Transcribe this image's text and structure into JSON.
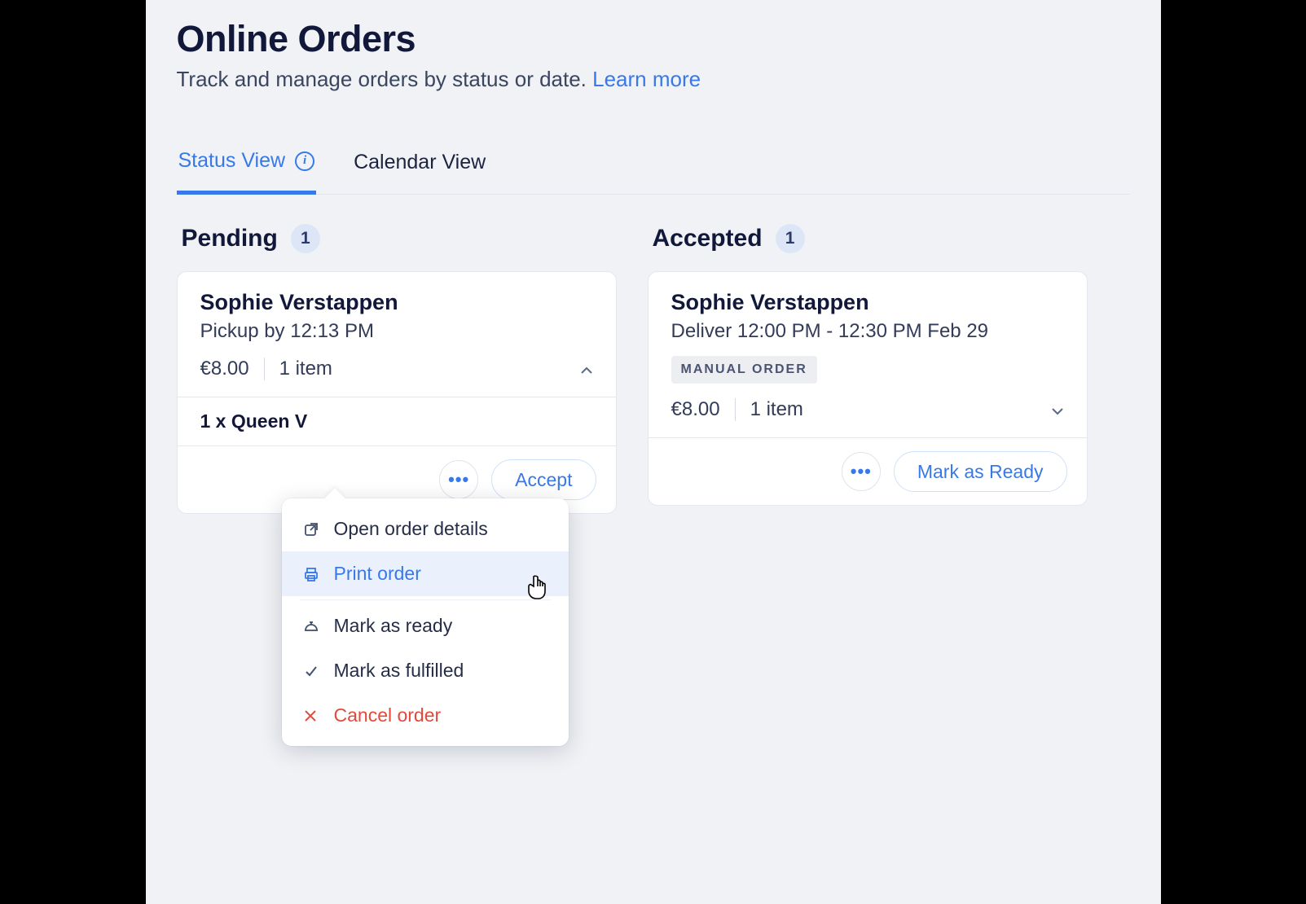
{
  "header": {
    "title": "Online Orders",
    "subtitle_prefix": "Track and manage orders by status or date. ",
    "learn_more": "Learn more"
  },
  "tabs": {
    "status": "Status View",
    "calendar": "Calendar View"
  },
  "columns": {
    "pending": {
      "title": "Pending",
      "count": "1"
    },
    "accepted": {
      "title": "Accepted",
      "count": "1"
    }
  },
  "pending_card": {
    "customer": "Sophie Verstappen",
    "fulfilment": "Pickup by 12:13 PM",
    "price": "€8.00",
    "items": "1 item",
    "line_item": "1 x Queen V",
    "accept_label": "Accept"
  },
  "accepted_card": {
    "customer": "Sophie Verstappen",
    "fulfilment": "Deliver 12:00 PM - 12:30 PM Feb 29",
    "tag": "MANUAL ORDER",
    "price": "€8.00",
    "items": "1 item",
    "ready_label": "Mark as Ready"
  },
  "menu": {
    "open_details": "Open order details",
    "print": "Print order",
    "mark_ready": "Mark as ready",
    "mark_fulfilled": "Mark as fulfilled",
    "cancel": "Cancel order"
  }
}
